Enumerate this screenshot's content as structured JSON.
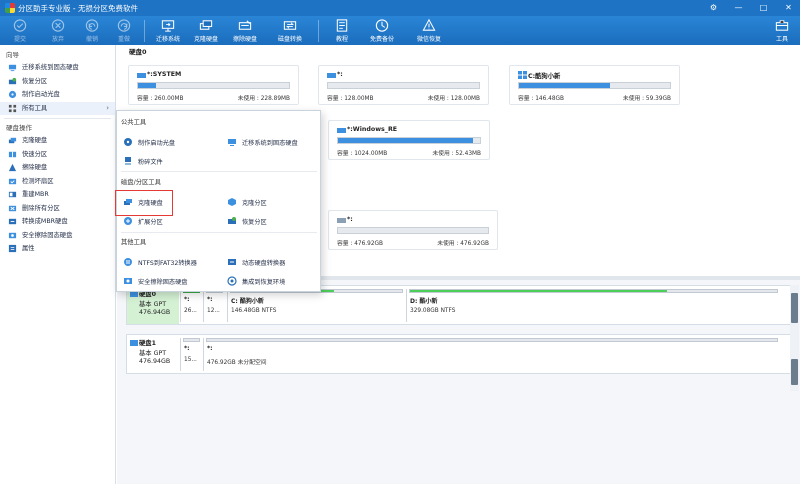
{
  "window": {
    "title": "分区助手专业版 - 无损分区免费软件"
  },
  "toolbar": {
    "buttons": [
      {
        "label": "提交",
        "icon": "check-icon",
        "disabled": true
      },
      {
        "label": "放弃",
        "icon": "cancel-icon",
        "disabled": true
      },
      {
        "label": "撤销",
        "icon": "undo-icon",
        "disabled": true
      },
      {
        "label": "重做",
        "icon": "redo-icon",
        "disabled": true
      },
      {
        "label": "迁移系统",
        "icon": "migrate-os-icon",
        "disabled": false
      },
      {
        "label": "克隆硬盘",
        "icon": "clone-disk-icon",
        "disabled": false
      },
      {
        "label": "擦除硬盘",
        "icon": "wipe-disk-icon",
        "disabled": false
      },
      {
        "label": "磁盘转换",
        "icon": "convert-disk-icon",
        "disabled": false
      },
      {
        "label": "教程",
        "icon": "tutorial-icon",
        "disabled": false
      },
      {
        "label": "免费备份",
        "icon": "backup-icon",
        "disabled": false
      },
      {
        "label": "微信恢复",
        "icon": "recover-icon",
        "disabled": false
      }
    ],
    "tools_label": "工具"
  },
  "sidebar": {
    "wizard_title": "向导",
    "wizard_items": [
      {
        "label": "迁移系统到固态硬盘"
      },
      {
        "label": "恢复分区"
      },
      {
        "label": "制作启动光盘"
      },
      {
        "label": "所有工具"
      }
    ],
    "disk_ops_title": "硬盘操作",
    "disk_ops_items": [
      {
        "label": "克隆硬盘"
      },
      {
        "label": "快速分区"
      },
      {
        "label": "擦除硬盘"
      },
      {
        "label": "检测坏扇区"
      },
      {
        "label": "重建MBR"
      },
      {
        "label": "删除所有分区"
      },
      {
        "label": "转换成MBR硬盘"
      },
      {
        "label": "安全擦除固态硬盘"
      },
      {
        "label": "属性"
      }
    ]
  },
  "main": {
    "disk0_header": "硬盘0",
    "cards": [
      {
        "name": "*:SYSTEM",
        "capacity": "容量 : 260.00MB",
        "free": "未使用 : 228.89MB",
        "used": 0.12
      },
      {
        "name": "*:",
        "capacity": "容量 : 128.00MB",
        "free": "未使用 : 128.00MB",
        "used": 0.0
      },
      {
        "name": "C:酷狗小新",
        "capacity": "容量 : 146.48GB",
        "free": "未使用 : 59.39GB",
        "used": 0.6
      },
      {
        "name": "*:Windows_RE",
        "capacity": "容量 : 1024.00MB",
        "free": "未使用 : 52.43MB",
        "used": 0.95
      },
      {
        "name": "*:",
        "capacity": "容量 : 476.92GB",
        "free": "未使用 : 476.92GB",
        "used": 0.0
      }
    ]
  },
  "dropdown": {
    "section1": "公共工具",
    "section1_items": [
      "制作启动光盘",
      "迁移系统到固态硬盘",
      "粉碎文件"
    ],
    "section2": "磁盘/分区工具",
    "section2_items": [
      "克隆硬盘",
      "克隆分区",
      "扩展分区",
      "恢复分区"
    ],
    "section3": "其他工具",
    "section3_items": [
      "NTFS到FAT32转换器",
      "动态硬盘转换器",
      "安全擦除固态硬盘",
      "集成到恢复环境"
    ]
  },
  "diskmap": {
    "disk0": {
      "name": "硬盘0",
      "type": "基本 GPT",
      "size": "476.94GB",
      "segments": [
        {
          "name": "*:",
          "info": "26..."
        },
        {
          "name": "*:",
          "info": "12..."
        },
        {
          "name": "C: 酷狗小新",
          "info": "146.48GB NTFS",
          "fill": 0.6
        },
        {
          "name": "D: 酷小新",
          "info": "329.08GB NTFS",
          "fill": 0.7
        }
      ]
    },
    "disk1": {
      "name": "硬盘1",
      "type": "基本 GPT",
      "size": "476.94GB",
      "segments": [
        {
          "name": "*:",
          "info": "15..."
        },
        {
          "name": "*:",
          "info": "476.92GB 未分配空间"
        }
      ]
    }
  },
  "colors": {
    "titlebar": "#1e73c4",
    "accent": "#3d8fe0",
    "partition_green": "#4cce5a",
    "highlight_box": "#e53935"
  }
}
